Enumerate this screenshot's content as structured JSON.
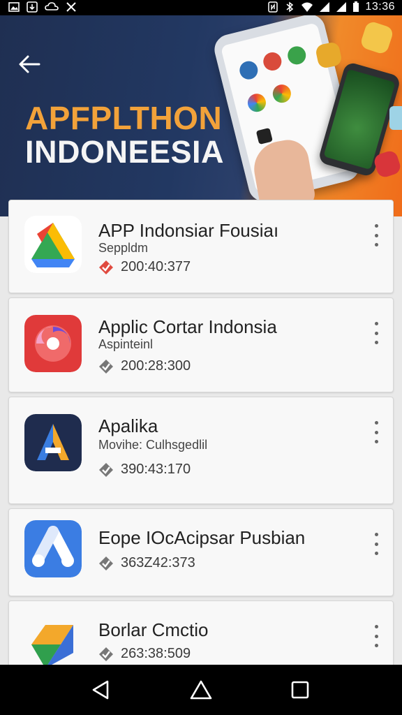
{
  "status_bar": {
    "time": "13:36",
    "icons": [
      "image-icon",
      "download-icon",
      "cloud-icon",
      "x-icon",
      "nfc-icon",
      "bluetooth-icon",
      "wifi-icon",
      "signal-icon",
      "battery-icon"
    ]
  },
  "hero": {
    "title": "APFPLTHON",
    "subtitle": "INDONEESIA",
    "colors": {
      "navy": "#223862",
      "orange": "#f08a2a",
      "title_gold": "#f2a23a"
    }
  },
  "apps": [
    {
      "name": "APP Indonsiar Fousiaı",
      "subtitle": "Seppldm",
      "meta": "200:40:377",
      "icon": "drive-icon",
      "check_color": "#e04a3f"
    },
    {
      "name": "Applic Cortar Indonsia",
      "subtitle": "Aspinteinl",
      "meta": "200:28:300",
      "icon": "swirl-icon",
      "check_color": "#777777"
    },
    {
      "name": "Apalika",
      "subtitle": "Movihe: Culhsgedlil",
      "meta": "390:43:170",
      "icon": "a-letter-icon",
      "check_color": "#777777"
    },
    {
      "name": "Eope IOcAcipsar Pusbian",
      "subtitle": "",
      "meta": "363Z42:373",
      "icon": "ads-icon",
      "check_color": "#777777"
    },
    {
      "name": "Borlar Cmctio",
      "subtitle": "",
      "meta": "263:38:509",
      "icon": "cube-icon",
      "check_color": "#777777"
    }
  ],
  "nav": {
    "buttons": [
      "back-icon",
      "home-icon",
      "recents-icon"
    ]
  }
}
